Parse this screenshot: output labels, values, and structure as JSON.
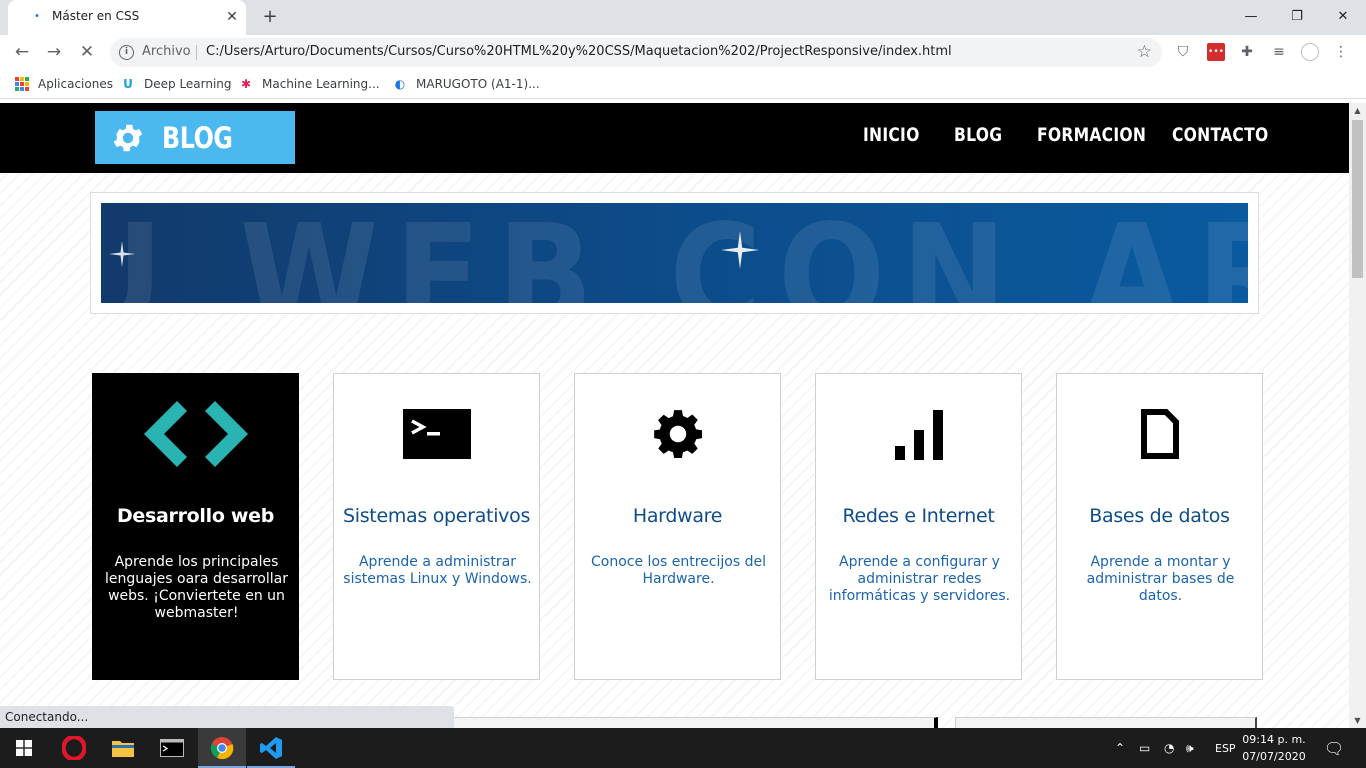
{
  "browser": {
    "tab_title": "Máster en CSS",
    "tab_close": "✕",
    "new_tab": "+",
    "window_buttons": {
      "minimize": "—",
      "maximize": "❐",
      "close": "✕"
    },
    "scheme_label": "Archivo",
    "url": "C:/Users/Arturo/Documents/Cursos/Curso%20HTML%20y%20CSS/Maquetacion%202/ProjectResponsive/index.html",
    "bookmarks": [
      {
        "label": "Aplicaciones",
        "icon": "apps-grid-icon"
      },
      {
        "label": "Deep Learning",
        "icon": "udacity-icon"
      },
      {
        "label": "Machine Learning...",
        "icon": "slack-icon"
      },
      {
        "label": "MARUGOTO (A1-1)...",
        "icon": "marugoto-icon"
      }
    ],
    "status_text": "Conectando..."
  },
  "site": {
    "logo_text": "BLOG",
    "menu": [
      "INICIO",
      "BLOG",
      "FORMACION",
      "CONTACTO"
    ],
    "banner_text": "U WEB CON ART",
    "cards": [
      {
        "icon": "code-icon",
        "title": "Desarrollo web",
        "description": "Aprende los principales lenguajes oara desarrollar webs. ¡Conviertete en un webmaster!",
        "highlighted": true
      },
      {
        "icon": "terminal-icon",
        "title": "Sistemas operativos",
        "description": "Aprende a administrar sistemas Linux y Windows.",
        "highlighted": false
      },
      {
        "icon": "gear-icon",
        "title": "Hardware",
        "description": "Conoce los entrecijos del Hardware.",
        "highlighted": false
      },
      {
        "icon": "signal-bars-icon",
        "title": "Redes e Internet",
        "description": "Aprende a configurar y administrar redes informáticas y servidores.",
        "highlighted": false
      },
      {
        "icon": "file-icon",
        "title": "Bases de datos",
        "description": "Aprende a montar y administrar bases de datos.",
        "highlighted": false
      }
    ],
    "colors": {
      "header_bg": "#000000",
      "logo_bg": "#4bb9f0",
      "card_title": "#0f4d8a",
      "code_icon": "#2ab3b3"
    }
  },
  "taskbar": {
    "language": "ESP",
    "time": "09:14 p. m.",
    "date": "07/07/2020"
  }
}
